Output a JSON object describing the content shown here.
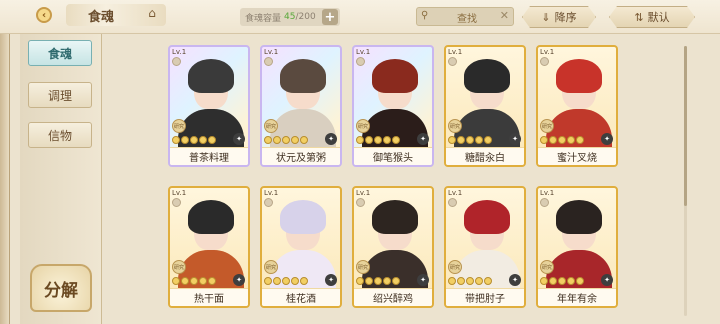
{
  "header": {
    "title": "食魂",
    "capacity_label": "食魂容量",
    "capacity_current": "45",
    "capacity_max": "/200",
    "search_placeholder": "查找",
    "sort_label": "降序",
    "filter_label": "默认"
  },
  "sidebar": {
    "tabs": [
      {
        "label": "食魂",
        "active": true
      },
      {
        "label": "调理",
        "active": false
      },
      {
        "label": "信物",
        "active": false
      }
    ],
    "decompose_label": "分解"
  },
  "cards": [
    {
      "name": "普茶料理",
      "level": "Lv.1",
      "tag": "研究",
      "frame": "rainbow",
      "hair": "#3a3a3a",
      "outfit": "#2e2e2e",
      "stars_lit": 5
    },
    {
      "name": "状元及第粥",
      "level": "Lv.1",
      "tag": "研究",
      "frame": "rainbow",
      "hair": "#5a4a3f",
      "outfit": "#d9cfc0",
      "stars_lit": 5
    },
    {
      "name": "御笔猴头",
      "level": "Lv.1",
      "tag": "研究",
      "frame": "rainbow",
      "hair": "#8a2a1e",
      "outfit": "#2b1d1a",
      "stars_lit": 5
    },
    {
      "name": "糖醋汆白",
      "level": "Lv.1",
      "tag": "研究",
      "frame": "gold",
      "hair": "#2a2a2a",
      "outfit": "#3b3b3b",
      "stars_lit": 5
    },
    {
      "name": "蜜汁叉烧",
      "level": "Lv.1",
      "tag": "研究",
      "frame": "gold",
      "hair": "#c8332a",
      "outfit": "#c0392b",
      "stars_lit": 5
    },
    {
      "name": "热干面",
      "level": "Lv.1",
      "tag": "研究",
      "frame": "gold",
      "hair": "#2a2a2a",
      "outfit": "#c45a2a",
      "stars_lit": 5
    },
    {
      "name": "桂花酒",
      "level": "Lv.1",
      "tag": "研究",
      "frame": "gold",
      "hair": "#d7d2ea",
      "outfit": "#efe8f5",
      "stars_lit": 5
    },
    {
      "name": "绍兴醉鸡",
      "level": "Lv.1",
      "tag": "研究",
      "frame": "gold",
      "hair": "#2d2520",
      "outfit": "#3a2f2a",
      "stars_lit": 5
    },
    {
      "name": "带把肘子",
      "level": "Lv.1",
      "tag": "研究",
      "frame": "gold",
      "hair": "#b0242a",
      "outfit": "#f2ece2",
      "stars_lit": 5
    },
    {
      "name": "年年有余",
      "level": "Lv.1",
      "tag": "研究",
      "frame": "gold",
      "hair": "#2a2320",
      "outfit": "#a8262a",
      "stars_lit": 5
    }
  ]
}
